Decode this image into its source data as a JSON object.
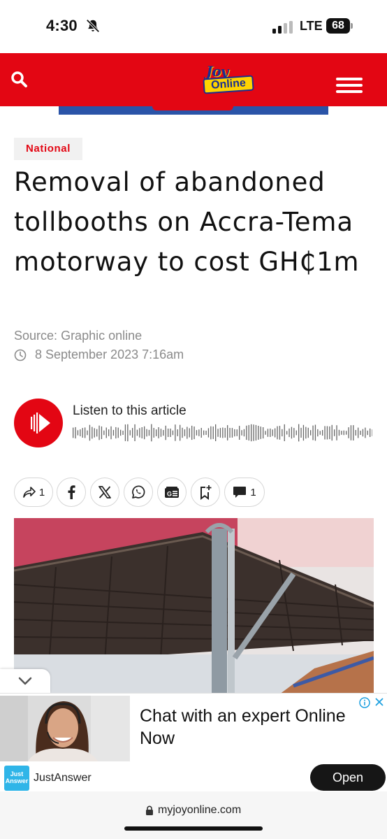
{
  "status_bar": {
    "time": "4:30",
    "network": "LTE",
    "battery": "68"
  },
  "header": {
    "logo_top": "Joy",
    "logo_bottom": "Online",
    "accent": "#e30613"
  },
  "article": {
    "category": "National",
    "title": "Removal of abandoned tollbooths on Accra-Tema motorway to cost GH₵1m",
    "source_label": "Source",
    "source_value": "Graphic online",
    "date": "8 September 2023 7:16am"
  },
  "audio": {
    "listen_label": "Listen to this article"
  },
  "share_bar": {
    "share_count": "1",
    "comment_count": "1",
    "icons": [
      "share-icon",
      "facebook-icon",
      "x-icon",
      "whatsapp-icon",
      "google-news-icon",
      "bookmark-add-icon",
      "comment-icon"
    ]
  },
  "ad": {
    "headline": "Chat with an expert Online Now",
    "brand": "JustAnswer",
    "brand_logo_text": "Just Answer",
    "cta": "Open"
  },
  "browser": {
    "url": "myjoyonline.com"
  }
}
